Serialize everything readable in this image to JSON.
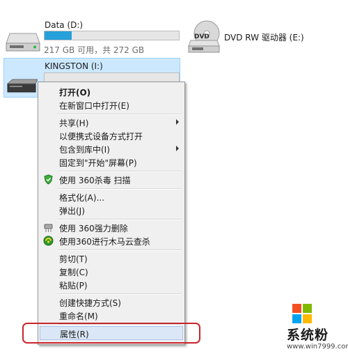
{
  "drives": {
    "data": {
      "name": "Data (D:)",
      "size_text": "217 GB 可用，共 272 GB",
      "used_fraction": 0.2,
      "icon": "hard-drive-icon"
    },
    "dvd": {
      "name": "DVD RW 驱动器 (E:)",
      "icon": "dvd-drive-icon",
      "badge": "DVD"
    },
    "kingston": {
      "name": "KINGSTON (I:)",
      "icon": "usb-drive-icon"
    }
  },
  "context_menu": {
    "open": "打开(O)",
    "open_new_window": "在新窗口中打开(E)",
    "share": "共享(H)",
    "open_as_portable": "以便携式设备方式打开",
    "include_in_library": "包含到库中(I)",
    "pin_to_start": "固定到\"开始\"屏幕(P)",
    "scan_360": "使用 360杀毒 扫描",
    "format": "格式化(A)...",
    "eject": "弹出(J)",
    "force_delete_360": "使用 360强力删除",
    "trojan_scan_360": "使用360进行木马云查杀",
    "cut": "剪切(T)",
    "copy": "复制(C)",
    "paste": "粘贴(P)",
    "create_shortcut": "创建快捷方式(S)",
    "rename": "重命名(M)",
    "properties": "属性(R)"
  },
  "watermark": {
    "text": "系统粉",
    "url": "www.win7999.com"
  },
  "colors": {
    "selection": "#cce8ff",
    "usage_bar": "#26a0da",
    "highlight_ring": "#c8242c"
  }
}
